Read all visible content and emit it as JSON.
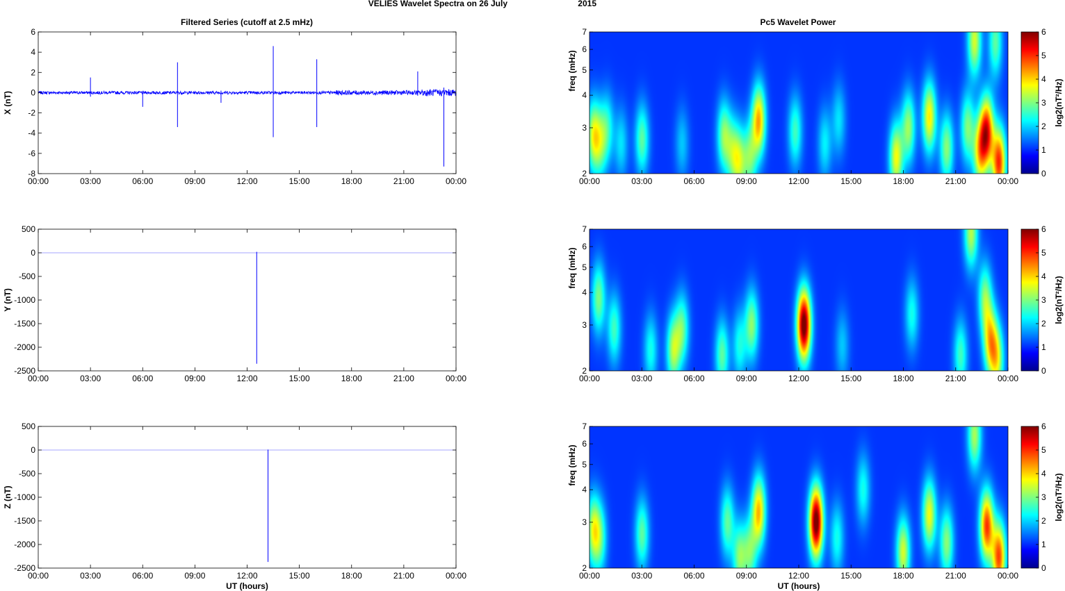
{
  "figure": {
    "title_main": "VELIES Wavelet Spectra on 26 July",
    "title_year": "2015",
    "left_title": "Filtered Series (cutoff at 2.5 mHz)",
    "right_title": "Pc5 Wavelet Power",
    "xlabel": "UT (hours)"
  },
  "chart_data": [
    {
      "type": "line",
      "id": "x-series",
      "ylabel": "X (nT)",
      "ylim": [
        -8,
        6
      ],
      "yticks": [
        -8,
        -6,
        -4,
        -2,
        0,
        2,
        4,
        6
      ],
      "xlim_hours": [
        0,
        24
      ],
      "xticks": [
        "00:00",
        "03:00",
        "06:00",
        "09:00",
        "12:00",
        "15:00",
        "18:00",
        "21:00",
        "00:00"
      ],
      "color": "#0000ff",
      "baseline_amplitude": 0.15,
      "spikes": [
        {
          "t": 3.0,
          "min": -0.4,
          "max": 1.5
        },
        {
          "t": 6.0,
          "min": -1.4,
          "max": 0.1
        },
        {
          "t": 8.0,
          "min": -3.4,
          "max": 3.0
        },
        {
          "t": 10.5,
          "min": -1.0,
          "max": 0.2
        },
        {
          "t": 13.5,
          "min": -4.4,
          "max": 4.6
        },
        {
          "t": 16.0,
          "min": -3.4,
          "max": 3.3
        },
        {
          "t": 21.8,
          "min": -0.3,
          "max": 2.1
        },
        {
          "t": 23.3,
          "min": -7.3,
          "max": 0.5
        }
      ]
    },
    {
      "type": "line",
      "id": "y-series",
      "ylabel": "Y (nT)",
      "ylim": [
        -2500,
        500
      ],
      "yticks": [
        -2500,
        -2000,
        -1500,
        -1000,
        -500,
        0,
        500
      ],
      "xlim_hours": [
        0,
        24
      ],
      "xticks": [
        "00:00",
        "03:00",
        "06:00",
        "09:00",
        "12:00",
        "15:00",
        "18:00",
        "21:00",
        "00:00"
      ],
      "color": "#0000ff",
      "spikes": [
        {
          "t": 12.55,
          "min": -2350,
          "max": 20
        }
      ]
    },
    {
      "type": "line",
      "id": "z-series",
      "ylabel": "Z (nT)",
      "ylim": [
        -2500,
        500
      ],
      "yticks": [
        -2500,
        -2000,
        -1500,
        -1000,
        -500,
        0,
        500
      ],
      "xlim_hours": [
        0,
        24
      ],
      "xticks": [
        "00:00",
        "03:00",
        "06:00",
        "09:00",
        "12:00",
        "15:00",
        "18:00",
        "21:00",
        "00:00"
      ],
      "color": "#0000ff",
      "spikes": [
        {
          "t": 13.2,
          "min": -2370,
          "max": 10
        }
      ]
    },
    {
      "type": "heatmap",
      "id": "x-power",
      "ylabel": "freq (mHz)",
      "ylim": [
        2,
        7
      ],
      "yscale": "log",
      "yticks": [
        2,
        3,
        4,
        5,
        6,
        7
      ],
      "xlim_hours": [
        0,
        24
      ],
      "xticks": [
        "00:00",
        "03:00",
        "06:00",
        "09:00",
        "12:00",
        "15:00",
        "18:00",
        "21:00",
        "00:00"
      ],
      "colorbar_label": "log2(nT²/Hz)",
      "clim": [
        0,
        6
      ],
      "cticks": [
        0,
        1,
        2,
        3,
        4,
        5,
        6
      ],
      "blobs": [
        {
          "t": 0.2,
          "f": 2.8,
          "v": 2.6
        },
        {
          "t": 0.6,
          "f": 2.6,
          "v": 1.7
        },
        {
          "t": 1.0,
          "f": 3.0,
          "v": 1.5
        },
        {
          "t": 1.8,
          "f": 2.6,
          "v": 1.2
        },
        {
          "t": 3.0,
          "f": 2.7,
          "v": 2.0
        },
        {
          "t": 5.3,
          "f": 2.6,
          "v": 1.0
        },
        {
          "t": 7.7,
          "f": 2.8,
          "v": 2.2
        },
        {
          "t": 8.2,
          "f": 2.4,
          "v": 1.8
        },
        {
          "t": 8.6,
          "f": 2.2,
          "v": 2.2
        },
        {
          "t": 9.2,
          "f": 2.3,
          "v": 2.0
        },
        {
          "t": 9.7,
          "f": 3.2,
          "v": 3.6
        },
        {
          "t": 11.8,
          "f": 2.9,
          "v": 1.8
        },
        {
          "t": 13.5,
          "f": 2.6,
          "v": 1.3
        },
        {
          "t": 14.3,
          "f": 3.2,
          "v": 1.2
        },
        {
          "t": 17.6,
          "f": 2.3,
          "v": 3.0
        },
        {
          "t": 18.3,
          "f": 3.0,
          "v": 2.4
        },
        {
          "t": 19.5,
          "f": 3.3,
          "v": 3.2
        },
        {
          "t": 20.5,
          "f": 2.5,
          "v": 2.3
        },
        {
          "t": 21.7,
          "f": 3.0,
          "v": 2.2
        },
        {
          "t": 22.4,
          "f": 2.4,
          "v": 3.0
        },
        {
          "t": 22.8,
          "f": 2.9,
          "v": 4.6
        },
        {
          "t": 23.5,
          "f": 2.2,
          "v": 4.5
        },
        {
          "t": 22.1,
          "f": 6.5,
          "v": 2.8
        },
        {
          "t": 23.3,
          "f": 6.4,
          "v": 2.0
        }
      ]
    },
    {
      "type": "heatmap",
      "id": "y-power",
      "ylabel": "freq (mHz)",
      "ylim": [
        2,
        7
      ],
      "yscale": "log",
      "yticks": [
        2,
        3,
        4,
        5,
        6,
        7
      ],
      "xlim_hours": [
        0,
        24
      ],
      "xticks": [
        "00:00",
        "03:00",
        "06:00",
        "09:00",
        "12:00",
        "15:00",
        "18:00",
        "21:00",
        "00:00"
      ],
      "colorbar_label": "log2(nT²/Hz)",
      "clim": [
        0,
        6
      ],
      "cticks": [
        0,
        1,
        2,
        3,
        4,
        5,
        6
      ],
      "blobs": [
        {
          "t": 0.5,
          "f": 3.8,
          "v": 2.2
        },
        {
          "t": 1.4,
          "f": 2.9,
          "v": 1.8
        },
        {
          "t": 3.5,
          "f": 2.4,
          "v": 1.5
        },
        {
          "t": 4.8,
          "f": 2.4,
          "v": 2.5
        },
        {
          "t": 5.3,
          "f": 2.9,
          "v": 2.0
        },
        {
          "t": 7.6,
          "f": 2.3,
          "v": 2.0
        },
        {
          "t": 8.6,
          "f": 2.5,
          "v": 1.5
        },
        {
          "t": 9.3,
          "f": 3.0,
          "v": 2.3
        },
        {
          "t": 12.3,
          "f": 3.0,
          "v": 6.0
        },
        {
          "t": 14.5,
          "f": 2.5,
          "v": 1.0
        },
        {
          "t": 18.5,
          "f": 3.3,
          "v": 1.5
        },
        {
          "t": 21.3,
          "f": 2.3,
          "v": 1.8
        },
        {
          "t": 22.7,
          "f": 3.8,
          "v": 2.2
        },
        {
          "t": 23.0,
          "f": 2.6,
          "v": 3.0
        },
        {
          "t": 23.4,
          "f": 2.2,
          "v": 2.6
        },
        {
          "t": 21.9,
          "f": 6.8,
          "v": 2.6
        }
      ]
    },
    {
      "type": "heatmap",
      "id": "z-power",
      "ylabel": "freq (mHz)",
      "ylim": [
        2,
        7
      ],
      "yscale": "log",
      "yticks": [
        2,
        3,
        4,
        5,
        6,
        7
      ],
      "xlim_hours": [
        0,
        24
      ],
      "xticks": [
        "00:00",
        "03:00",
        "06:00",
        "09:00",
        "12:00",
        "15:00",
        "18:00",
        "21:00",
        "00:00"
      ],
      "colorbar_label": "log2(nT²/Hz)",
      "clim": [
        0,
        6
      ],
      "cticks": [
        0,
        1,
        2,
        3,
        4,
        5,
        6
      ],
      "blobs": [
        {
          "t": 0.2,
          "f": 2.8,
          "v": 2.6
        },
        {
          "t": 0.6,
          "f": 2.6,
          "v": 1.7
        },
        {
          "t": 3.0,
          "f": 2.7,
          "v": 2.0
        },
        {
          "t": 7.9,
          "f": 3.0,
          "v": 2.0
        },
        {
          "t": 8.6,
          "f": 2.2,
          "v": 2.2
        },
        {
          "t": 9.2,
          "f": 2.3,
          "v": 2.0
        },
        {
          "t": 9.7,
          "f": 3.3,
          "v": 3.5
        },
        {
          "t": 13.0,
          "f": 3.0,
          "v": 6.0
        },
        {
          "t": 14.2,
          "f": 2.6,
          "v": 1.5
        },
        {
          "t": 15.7,
          "f": 4.0,
          "v": 1.5
        },
        {
          "t": 18.0,
          "f": 2.3,
          "v": 2.8
        },
        {
          "t": 19.5,
          "f": 3.2,
          "v": 3.0
        },
        {
          "t": 20.5,
          "f": 2.5,
          "v": 2.3
        },
        {
          "t": 22.8,
          "f": 2.9,
          "v": 4.4
        },
        {
          "t": 23.5,
          "f": 2.2,
          "v": 4.3
        },
        {
          "t": 22.1,
          "f": 6.5,
          "v": 2.5
        }
      ]
    }
  ]
}
